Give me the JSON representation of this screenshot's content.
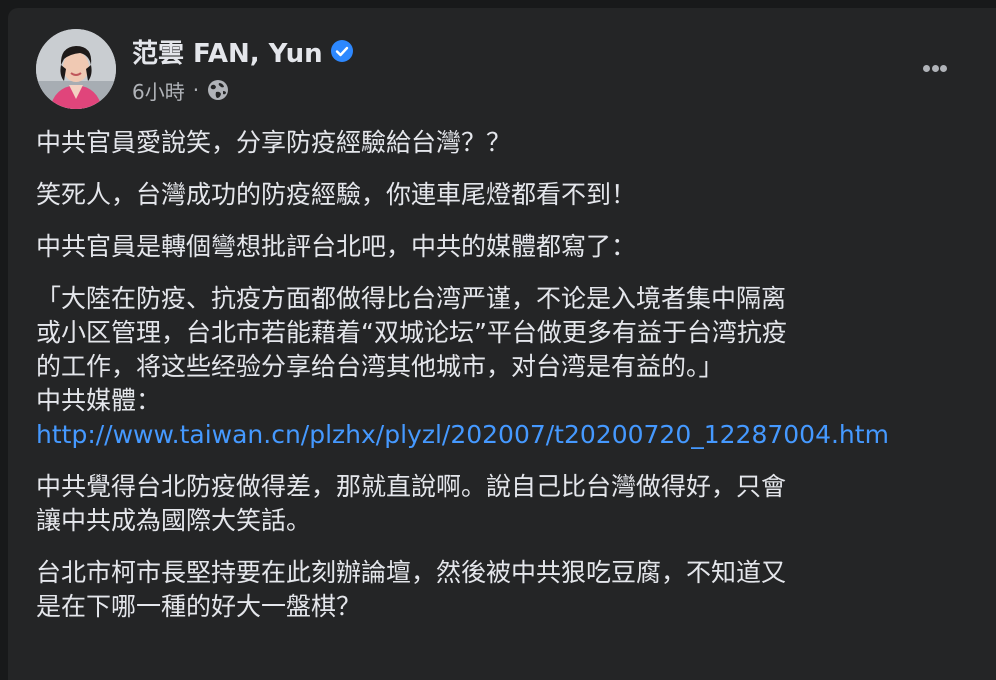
{
  "post": {
    "author": {
      "name": "范雲 FAN, Yun",
      "verified": true
    },
    "meta": {
      "time": "6小時",
      "separator": "·",
      "privacy_icon": "globe-icon"
    },
    "more_icon": "more-options-icon",
    "paragraphs": [
      "中共官員愛說笑，分享防疫經驗給台灣？？",
      "笑死人，台灣成功的防疫經驗，你連車尾燈都看不到！",
      "中共官員是轉個彎想批評台北吧，中共的媒體都寫了："
    ],
    "quote": "「大陸在防疫、抗疫方面都做得比台湾严谨，不论是入境者集中隔离\n或小区管理，台北市若能藉着“双城论坛”平台做更多有益于台湾抗疫\n的工作，将这些经验分享给台湾其他城市，对台湾是有益的。」",
    "source_label": "中共媒體：",
    "source_link": "http://www.taiwan.cn/plzhx/plyzl/202007/t20200720_12287004.htm",
    "paragraphs_after": [
      "中共覺得台北防疫做得差，那就直說啊。說自己比台灣做得好，只會\n讓中共成為國際大笑話。",
      "台北市柯市長堅持要在此刻辦論壇，然後被中共狠吃豆腐，不知道又\n是在下哪一種的好大一盤棋？"
    ]
  },
  "colors": {
    "background": "#18191a",
    "card": "#242526",
    "text_primary": "#e4e6eb",
    "text_secondary": "#b0b3b8",
    "link": "#4599ff",
    "verified_badge": "#2d88ff"
  }
}
